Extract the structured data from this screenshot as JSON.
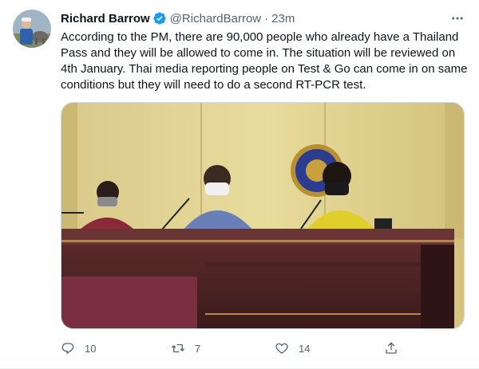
{
  "tweet": {
    "author_name": "Richard Barrow",
    "verified_icon": "verified-badge-icon",
    "handle": "@RichardBarrow",
    "separator": "·",
    "time": "23m",
    "more_icon": "more-dots-icon",
    "text": "According to the PM, there are 90,000 people who already have a Thailand Pass and they will be allowed to come in. The situation will be reviewed on 4th January. Thai media reporting people on Test & Go can come in on same conditions but they will need to do a second RT-PCR test.",
    "accent_color": "#1d9bf0",
    "media_description_icon": "press-conference-photo"
  },
  "actions": {
    "reply_count": "10",
    "retweet_count": "7",
    "like_count": "14",
    "reply_icon": "reply-icon",
    "retweet_icon": "retweet-icon",
    "like_icon": "heart-icon",
    "share_icon": "share-icon"
  }
}
